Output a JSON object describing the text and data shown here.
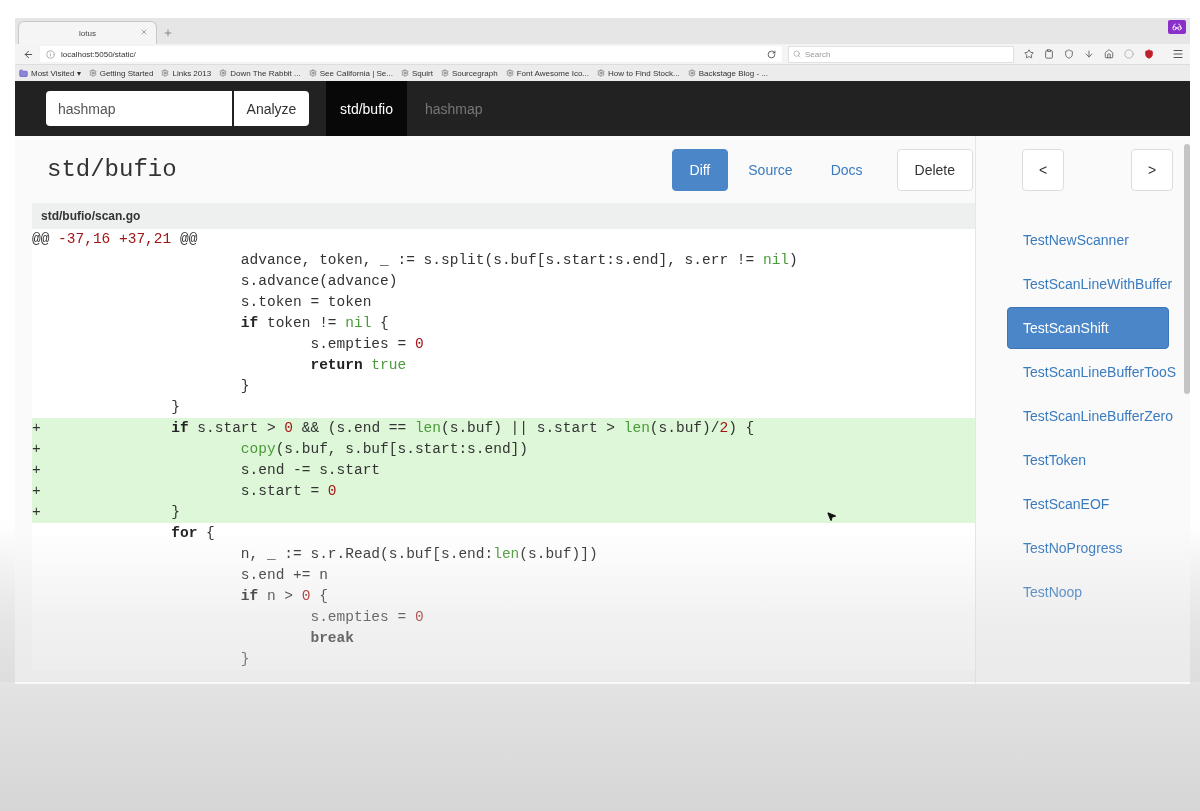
{
  "browser": {
    "tab_title": "lotus",
    "url": "localhost:5050/static/",
    "search": {
      "placeholder": "Search"
    },
    "bookmarks": [
      {
        "label": "Most Visited ▾",
        "kind": "folder"
      },
      {
        "label": "Getting Started",
        "kind": "link"
      },
      {
        "label": "Links 2013",
        "kind": "link"
      },
      {
        "label": "Down The Rabbit ...",
        "kind": "link"
      },
      {
        "label": "See California | Se...",
        "kind": "link"
      },
      {
        "label": "Squirt",
        "kind": "link"
      },
      {
        "label": "Sourcegraph",
        "kind": "link"
      },
      {
        "label": "Font Awesome Ico...",
        "kind": "link"
      },
      {
        "label": "How to Find Stock...",
        "kind": "link"
      },
      {
        "label": "Backstage Blog - ...",
        "kind": "link"
      }
    ]
  },
  "navbar": {
    "query": {
      "value": "hashmap"
    },
    "analyze_button": "Analyze",
    "tabs": [
      {
        "label": "std/bufio",
        "selected": true
      },
      {
        "label": "hashmap",
        "selected": false
      }
    ]
  },
  "package": {
    "title": "std/bufio",
    "views": [
      {
        "label": "Diff",
        "selected": true
      },
      {
        "label": "Source",
        "selected": false
      },
      {
        "label": "Docs",
        "selected": false
      },
      {
        "label": "Delete",
        "selected": false,
        "kind": "action"
      }
    ]
  },
  "diff": {
    "file": "std/bufio/scan.go",
    "lines": [
      {
        "kind": "hunk",
        "added": false,
        "tokens": [
          {
            "text": "@@ ",
            "kind": "plain"
          },
          {
            "text": "-37,16 +37,21",
            "kind": "number"
          },
          {
            "text": " @@",
            "kind": "plain"
          }
        ]
      },
      {
        "kind": "code",
        "added": false,
        "tokens": [
          {
            "text": "\t\t\tadvance, token, _ := s.split(s.buf[s.start:s.end], s.err != ",
            "kind": "plain"
          },
          {
            "text": "nil",
            "kind": "builtin"
          },
          {
            "text": ")",
            "kind": "plain"
          }
        ]
      },
      {
        "kind": "code",
        "added": false,
        "tokens": [
          {
            "text": "\t\t\ts.advance(advance)",
            "kind": "plain"
          }
        ]
      },
      {
        "kind": "code",
        "added": false,
        "tokens": [
          {
            "text": "\t\t\ts.token = token",
            "kind": "plain"
          }
        ]
      },
      {
        "kind": "code",
        "added": false,
        "tokens": [
          {
            "text": "\t\t\tif",
            "kind": "keyword"
          },
          {
            "text": " token != ",
            "kind": "plain"
          },
          {
            "text": "nil",
            "kind": "builtin"
          },
          {
            "text": " {",
            "kind": "plain"
          }
        ]
      },
      {
        "kind": "code",
        "added": false,
        "tokens": [
          {
            "text": "\t\t\t\ts.empties = ",
            "kind": "plain"
          },
          {
            "text": "0",
            "kind": "number"
          }
        ]
      },
      {
        "kind": "code",
        "added": false,
        "tokens": [
          {
            "text": "\t\t\t\treturn",
            "kind": "keyword"
          },
          {
            "text": " true",
            "kind": "builtin"
          }
        ]
      },
      {
        "kind": "code",
        "added": false,
        "tokens": [
          {
            "text": "\t\t\t}",
            "kind": "plain"
          }
        ]
      },
      {
        "kind": "code",
        "added": false,
        "tokens": [
          {
            "text": "\t\t}",
            "kind": "plain"
          }
        ]
      },
      {
        "kind": "code",
        "added": true,
        "prefix": "+",
        "tokens": [
          {
            "text": "\t\tif",
            "kind": "keyword"
          },
          {
            "text": " s.start > ",
            "kind": "plain"
          },
          {
            "text": "0",
            "kind": "number"
          },
          {
            "text": " && (s.end == ",
            "kind": "plain"
          },
          {
            "text": "len",
            "kind": "builtin"
          },
          {
            "text": "(s.buf) || s.start > ",
            "kind": "plain"
          },
          {
            "text": "len",
            "kind": "builtin"
          },
          {
            "text": "(s.buf)/",
            "kind": "plain"
          },
          {
            "text": "2",
            "kind": "number"
          },
          {
            "text": ") {",
            "kind": "plain"
          }
        ]
      },
      {
        "kind": "code",
        "added": true,
        "prefix": "+",
        "tokens": [
          {
            "text": "\t\t\tcopy",
            "kind": "builtin"
          },
          {
            "text": "(s.buf, s.buf[s.start:s.end])",
            "kind": "plain"
          }
        ]
      },
      {
        "kind": "code",
        "added": true,
        "prefix": "+",
        "tokens": [
          {
            "text": "\t\t\ts.end -= s.start",
            "kind": "plain"
          }
        ]
      },
      {
        "kind": "code",
        "added": true,
        "prefix": "+",
        "tokens": [
          {
            "text": "\t\t\ts.start = ",
            "kind": "plain"
          },
          {
            "text": "0",
            "kind": "number"
          }
        ]
      },
      {
        "kind": "code",
        "added": true,
        "prefix": "+",
        "tokens": [
          {
            "text": "\t\t}",
            "kind": "plain"
          }
        ]
      },
      {
        "kind": "code",
        "added": false,
        "tokens": [
          {
            "text": "\t\tfor",
            "kind": "keyword"
          },
          {
            "text": " {",
            "kind": "plain"
          }
        ]
      },
      {
        "kind": "code",
        "added": false,
        "tokens": [
          {
            "text": "\t\t\tn, _ := s.r.Read(s.buf[s.end:",
            "kind": "plain"
          },
          {
            "text": "len",
            "kind": "builtin"
          },
          {
            "text": "(s.buf)])",
            "kind": "plain"
          }
        ]
      },
      {
        "kind": "code",
        "added": false,
        "tokens": [
          {
            "text": "\t\t\ts.end += n",
            "kind": "plain"
          }
        ]
      },
      {
        "kind": "code",
        "added": false,
        "tokens": [
          {
            "text": "\t\t\tif",
            "kind": "keyword"
          },
          {
            "text": " n > ",
            "kind": "plain"
          },
          {
            "text": "0",
            "kind": "number"
          },
          {
            "text": " {",
            "kind": "plain"
          }
        ]
      },
      {
        "kind": "code",
        "added": false,
        "tokens": [
          {
            "text": "\t\t\t\ts.empties = ",
            "kind": "plain"
          },
          {
            "text": "0",
            "kind": "number"
          }
        ]
      },
      {
        "kind": "code",
        "added": false,
        "tokens": [
          {
            "text": "\t\t\t\tbreak",
            "kind": "keyword"
          }
        ]
      },
      {
        "kind": "code",
        "added": false,
        "tokens": [
          {
            "text": "\t\t\t}",
            "kind": "plain"
          }
        ]
      }
    ]
  },
  "sidebar": {
    "prev_button": "<",
    "next_button": ">",
    "tests": [
      {
        "label": "TestNewScanner",
        "selected": false
      },
      {
        "label": "TestScanLineWithBuffer",
        "selected": false
      },
      {
        "label": "TestScanShift",
        "selected": true
      },
      {
        "label": "TestScanLineBufferTooS",
        "selected": false
      },
      {
        "label": "TestScanLineBufferZero",
        "selected": false
      },
      {
        "label": "TestToken",
        "selected": false
      },
      {
        "label": "TestScanEOF",
        "selected": false
      },
      {
        "label": "TestNoProgress",
        "selected": false
      },
      {
        "label": "TestNoop",
        "selected": false
      }
    ]
  }
}
